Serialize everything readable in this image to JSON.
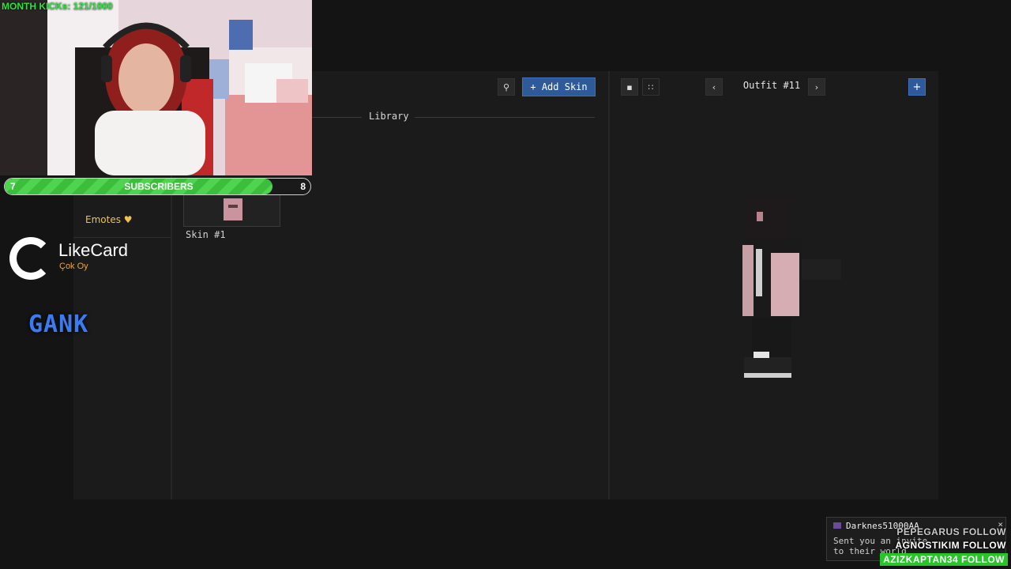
{
  "app": {
    "sidebar": {
      "items": [
        {
          "label": "Emotes",
          "icon": "heart-icon"
        }
      ]
    },
    "library": {
      "title": "Library",
      "search_icon": "search-icon",
      "add_skin_label": "+ Add Skin",
      "skins": [
        {
          "label": "Skin #1"
        }
      ]
    },
    "outfit": {
      "title": "Outfit #11",
      "prev_icon": "chevron-left-icon",
      "next_icon": "chevron-right-icon",
      "add_label": "+",
      "view_icons": [
        "single-view-icon",
        "grid-view-icon"
      ]
    }
  },
  "overlay": {
    "month_kicks": "MONTH KICKs: 121/1000",
    "subscribers": {
      "label": "SUBSCRIBERS",
      "current": "7",
      "goal": "8",
      "progress": 0.875
    },
    "sponsor": {
      "name": "LikeCard",
      "tagline": "Çok Oy"
    },
    "gank_logo": "GANK",
    "notification": {
      "user": "Darknes51000AA",
      "message_line1": "Sent you an invite",
      "message_line2": "to their world",
      "close_label": "×"
    },
    "follows": [
      "PEPEGARUS FOLLOW",
      "AGNOSTIKIM FOLLOW",
      "AZIZKAPTAN34 FOLLOW"
    ]
  },
  "colors": {
    "accent_blue": "#2f5a9a",
    "gold": "#f0c24a",
    "kick_green": "#29e53b",
    "follow_green": "#27c52a"
  }
}
